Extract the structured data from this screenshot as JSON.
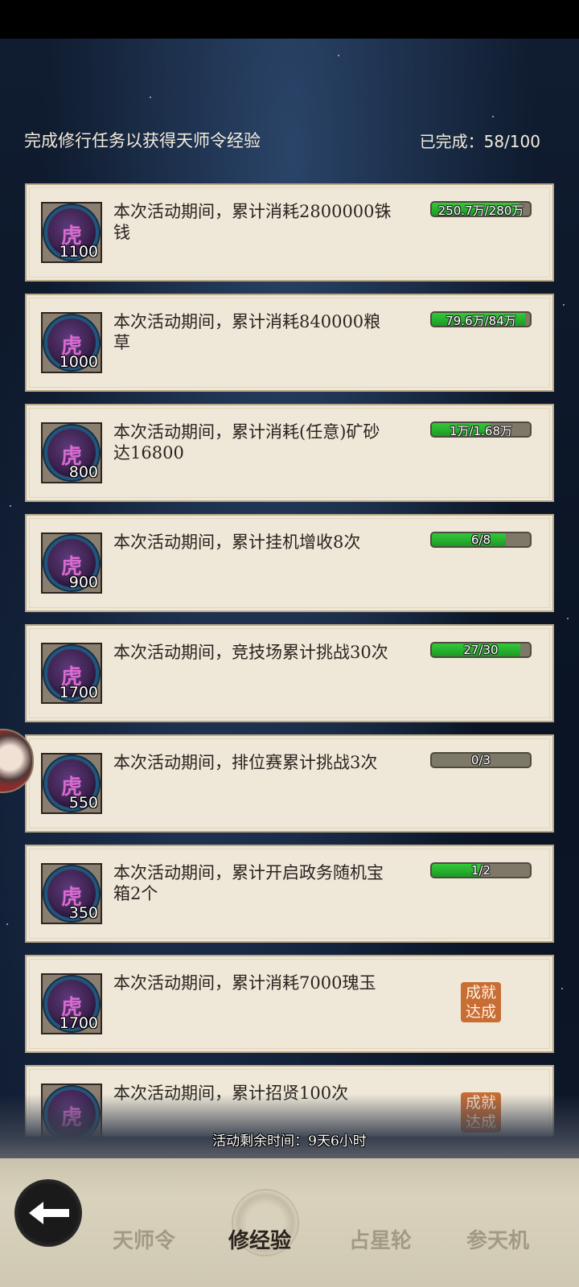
{
  "header": {
    "title": "完成修行任务以获得天师令经验",
    "progress": "已完成：58/100"
  },
  "tasks": [
    {
      "description": "本次活动期间，累计消耗2800000铢钱",
      "reward": "1100",
      "progress_text": "250.7万/280万",
      "progress_fraction": 0.895,
      "completed": false
    },
    {
      "description": "本次活动期间，累计消耗840000粮草",
      "reward": "1000",
      "progress_text": "79.6万/84万",
      "progress_fraction": 0.948,
      "completed": false
    },
    {
      "description": "本次活动期间，累计消耗(任意)矿砂达16800",
      "reward": "800",
      "progress_text": "1万/1.68万",
      "progress_fraction": 0.595,
      "completed": false
    },
    {
      "description": "本次活动期间，累计挂机增收8次",
      "reward": "900",
      "progress_text": "6/8",
      "progress_fraction": 0.75,
      "completed": false
    },
    {
      "description": "本次活动期间，竞技场累计挑战30次",
      "reward": "1700",
      "progress_text": "27/30",
      "progress_fraction": 0.9,
      "completed": false
    },
    {
      "description": "本次活动期间，排位赛累计挑战3次",
      "reward": "550",
      "progress_text": "0/3",
      "progress_fraction": 0.0,
      "completed": false
    },
    {
      "description": "本次活动期间，累计开启政务随机宝箱2个",
      "reward": "350",
      "progress_text": "1/2",
      "progress_fraction": 0.5,
      "completed": false
    },
    {
      "description": "本次活动期间，累计消耗7000瑰玉",
      "reward": "1700",
      "progress_text": "",
      "progress_fraction": 1.0,
      "completed": true
    },
    {
      "description": "本次活动期间，累计招贤100次",
      "reward": "",
      "progress_text": "",
      "progress_fraction": 1.0,
      "completed": true
    }
  ],
  "completed_stamp": {
    "line1": "成就",
    "line2": "达成"
  },
  "reward_seal_glyph": "虎",
  "time_remaining": "活动剩余时间：9天6小时",
  "nav": {
    "back_icon": "arrow-left-icon",
    "tabs": [
      {
        "label": "天师令",
        "active": false
      },
      {
        "label": "修经验",
        "active": true
      },
      {
        "label": "占星轮",
        "active": false
      },
      {
        "label": "参天机",
        "active": false
      }
    ]
  },
  "colors": {
    "progress_green": "#2fb834",
    "stamp_orange": "#c86d34",
    "card_bg": "#efe8d8"
  }
}
